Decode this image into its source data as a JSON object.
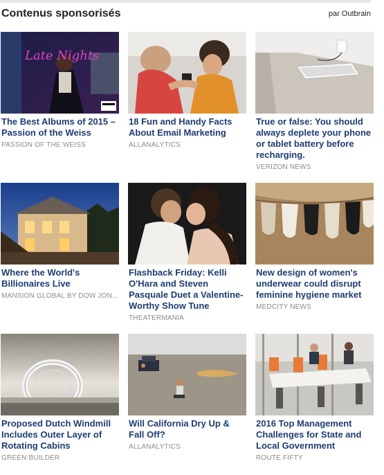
{
  "header": {
    "title": "Contenus sponsorisés",
    "attribution": "par Outbrain"
  },
  "cards": [
    {
      "headline": "The Best Albums of 2015 – Passion of the Weiss",
      "source": "PASSION OF THE WEISS",
      "thumb_icon": "album-cover-image"
    },
    {
      "headline": "18 Fun and Handy Facts About Email Marketing",
      "source": "ALLANALYTICS",
      "thumb_icon": "couple-phone-image"
    },
    {
      "headline": "True or false: You should always deplete your phone or tablet battery before recharging.",
      "source": "VERIZON NEWS",
      "thumb_icon": "tablet-charging-image"
    },
    {
      "headline": "Where the World's Billionaires Live",
      "source": "MANSION GLOBAL BY DOW JON...",
      "thumb_icon": "mansion-image"
    },
    {
      "headline": "Flashback Friday: Kelli O'Hara and Steven Pasquale Duet a Valentine-Worthy Show Tune",
      "source": "THEATERMANIA",
      "thumb_icon": "couple-kiss-image"
    },
    {
      "headline": "New design of women's underwear could disrupt feminine hygiene market",
      "source": "MEDCITY NEWS",
      "thumb_icon": "clothesline-image"
    },
    {
      "headline": "Proposed Dutch Windmill Includes Outer Layer of Rotating Cabins",
      "source": "GREEN BUILDER",
      "thumb_icon": "windmill-ring-image"
    },
    {
      "headline": "Will California Dry Up & Fall Off?",
      "source": "ALLANALYTICS",
      "thumb_icon": "desert-car-image"
    },
    {
      "headline": "2016 Top Management Challenges for State and Local Government",
      "source": "ROUTE FIFTY",
      "thumb_icon": "office-meeting-image"
    }
  ],
  "album_cover_text": "Late Nights"
}
